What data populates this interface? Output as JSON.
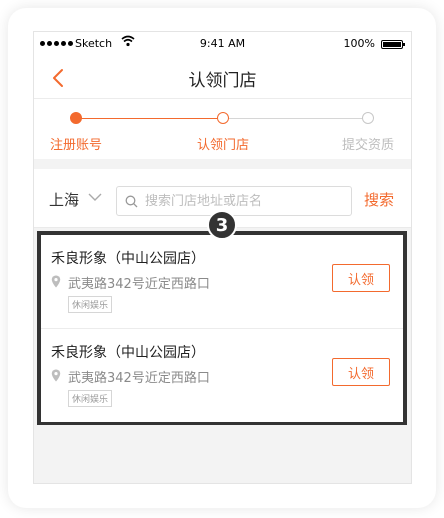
{
  "status_bar": {
    "carrier": "Sketch",
    "time": "9:41 AM",
    "battery": "100%"
  },
  "nav": {
    "title": "认领门店"
  },
  "steps": [
    {
      "label": "注册账号",
      "state": "done"
    },
    {
      "label": "认领门店",
      "state": "current"
    },
    {
      "label": "提交资质",
      "state": "todo"
    }
  ],
  "search": {
    "city": "上海",
    "placeholder": "搜索门店地址或店名",
    "button_label": "搜索"
  },
  "shops": [
    {
      "name": "禾良形象（中山公园店）",
      "address": "武夷路342号近定西路口",
      "tag": "休闲娱乐",
      "claim_label": "认领"
    },
    {
      "name": "禾良形象（中山公园店）",
      "address": "武夷路342号近定西路口",
      "tag": "休闲娱乐",
      "claim_label": "认领"
    }
  ],
  "annotation": {
    "badge": "3"
  },
  "colors": {
    "accent": "#f36a2e",
    "frame": "#333333",
    "muted": "#bdbdbd"
  }
}
